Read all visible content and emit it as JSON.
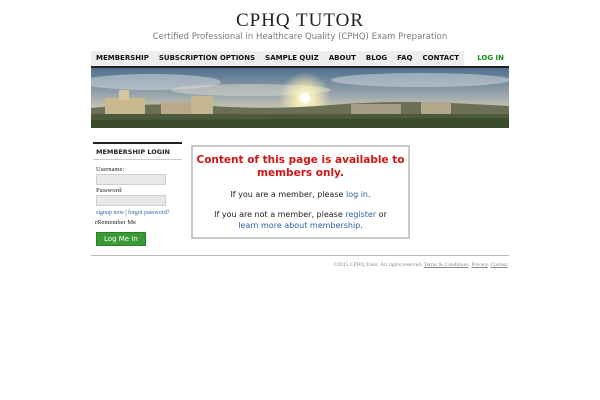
{
  "site": {
    "title": "CPHQ TUTOR",
    "tagline": "Certified Professional in Healthcare Quality (CPHQ) Exam Preparation"
  },
  "nav": {
    "items": [
      "MEMBERSHIP",
      "SUBSCRIPTION OPTIONS",
      "SAMPLE QUIZ",
      "ABOUT",
      "BLOG",
      "FAQ",
      "CONTACT"
    ],
    "login_label": "LOG IN"
  },
  "sidebar": {
    "title": "MEMBERSHIP LOGIN",
    "username_label": "Username:",
    "password_label": "Password:",
    "signup_link": "signup now",
    "separator": "|",
    "forgot_link": "forgot password?",
    "remember_label": "Remember Me",
    "login_button": "Log Me In"
  },
  "notice": {
    "title_line1": "Content of this page is available to",
    "title_line2": "members only.",
    "member_prefix": "If you are a member, please ",
    "member_link": "log in",
    "member_suffix": ".",
    "nonmember_prefix": "If you are not a member, please ",
    "register_link": "register",
    "nonmember_mid": " or",
    "learn_link": "learn more about membership",
    "learn_suffix": "."
  },
  "footer": {
    "copyright": "©2015 CPHQ Tutor. All rights reserved. ",
    "terms": "Terms & Conditions",
    "privacy": "Privacy",
    "contact": "Contact",
    "dot": ". "
  },
  "colors": {
    "accent_green": "#3a9a35",
    "notice_red": "#d01515",
    "link_blue": "#2a63a8"
  }
}
